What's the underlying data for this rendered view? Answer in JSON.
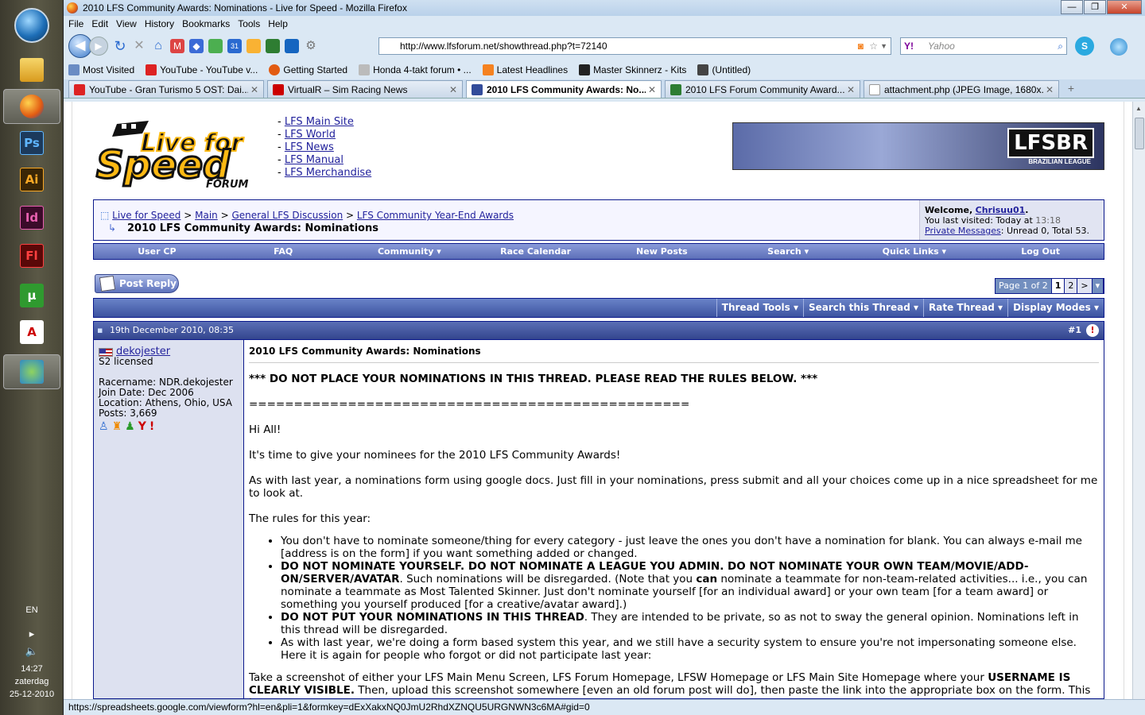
{
  "taskbar": {
    "language": "EN",
    "time": "14:27",
    "day": "zaterdag",
    "date": "25-12-2010",
    "apps": [
      {
        "label": "Ps",
        "color": "#1c3a5c",
        "fg": "#5fb6ff"
      },
      {
        "label": "Ai",
        "color": "#3a2606",
        "fg": "#f9a825"
      },
      {
        "label": "Id",
        "color": "#3b0b2a",
        "fg": "#e860b0"
      },
      {
        "label": "Fl",
        "color": "#5a0808",
        "fg": "#ff4040"
      }
    ]
  },
  "browser": {
    "title": "2010 LFS Community Awards: Nominations - Live for Speed - Mozilla Firefox",
    "menu": [
      "File",
      "Edit",
      "View",
      "History",
      "Bookmarks",
      "Tools",
      "Help"
    ],
    "url": "http://www.lfsforum.net/showthread.php?t=72140",
    "search_placeholder": "Yahoo",
    "bookmarks": [
      "Most Visited",
      "YouTube - YouTube v...",
      "Getting Started",
      "Honda 4-takt forum • ...",
      "Latest Headlines",
      "Master Skinnerz - Kits",
      "(Untitled)"
    ],
    "tabs": [
      {
        "label": "YouTube - Gran Turismo 5 OST: Dai...",
        "selected": false
      },
      {
        "label": "VirtualR – Sim Racing News",
        "selected": false
      },
      {
        "label": "2010 LFS Community Awards: No...",
        "selected": true
      },
      {
        "label": "2010 LFS Forum Community Award...",
        "selected": false
      },
      {
        "label": "attachment.php (JPEG Image, 1680x...",
        "selected": false
      }
    ],
    "status": "https://spreadsheets.google.com/viewform?hl=en&pli=1&formkey=dExXakxNQ0JmU2RhdXZNQU5URGNWN3c6MA#gid=0"
  },
  "header": {
    "logo_line1": "Live for",
    "logo_line2": "Speed",
    "logo_line3": "FORUM",
    "links": [
      "LFS Main Site",
      "LFS World",
      "LFS News",
      "LFS Manual",
      "LFS Merchandise"
    ],
    "banner": "LFSBR",
    "banner_sub": "BRAZILIAN LEAGUE"
  },
  "breadcrumb": {
    "items": [
      "Live for Speed",
      "Main",
      "General LFS Discussion",
      "LFS Community Year-End Awards"
    ],
    "title": "2010 LFS Community Awards: Nominations"
  },
  "welcome": {
    "prefix": "Welcome,",
    "user": "Chrisuu01",
    "last_visit_label": "You last visited: Today at",
    "last_visit_time": "13:18",
    "pm_link": "Private Messages",
    "pm_text": ": Unread 0, Total 53."
  },
  "navstrip": [
    "User CP",
    "FAQ",
    "Community ▾",
    "Race Calendar",
    "New Posts",
    "Search ▾",
    "Quick Links ▾",
    "Log Out"
  ],
  "post_reply": "Post Reply",
  "pager": {
    "label": "Page 1 of 2",
    "pages": [
      "1",
      "2",
      ">",
      "▾"
    ]
  },
  "thread_tools": [
    "Thread Tools ▾",
    "Search this Thread ▾",
    "Rate Thread ▾",
    "Display Modes ▾"
  ],
  "post": {
    "date": "19th December 2010, 08:35",
    "number": "#1",
    "user": {
      "name": "dekojester",
      "rank": "S2 licensed",
      "racername": "Racername: NDR.dekojester",
      "joined": "Join Date: Dec 2006",
      "location": "Location: Athens, Ohio, USA",
      "posts": "Posts: 3,669"
    },
    "title": "2010 LFS Community Awards: Nominations",
    "warning": "*** DO NOT PLACE YOUR NOMINATIONS IN THIS THREAD. PLEASE READ THE RULES BELOW. ***",
    "divider": "=================================================",
    "greeting": "Hi All!",
    "p1": "It's time to give your nominees for the 2010 LFS Community Awards!",
    "p2": "As with last year, a nominations form using google docs. Just fill in your nominations, press submit and all your choices come up in a nice spreadsheet for me to look at.",
    "rules_intro": "The rules for this year:",
    "rule1": "You don't have to nominate someone/thing for every category - just leave the ones you don't have a nomination for blank. You can always e-mail me [address is on the form] if you want something added or changed.",
    "rule2_bold": "DO NOT NOMINATE YOURSELF. DO NOT NOMINATE A LEAGUE YOU ADMIN. DO NOT NOMINATE YOUR OWN TEAM/MOVIE/ADD-ON/SERVER/AVATAR",
    "rule2_a": ". Such nominations will be disregarded. (Note that you ",
    "rule2_can": "can",
    "rule2_b": " nominate a teammate for non-team-related activities... i.e., you can nominate a teammate as Most Talented Skinner. Just don't nominate yourself [for an individual award] or your own team [for a team award] or something you yourself produced [for a creative/avatar award].)",
    "rule3_bold": "DO NOT PUT YOUR NOMINATIONS IN THIS THREAD",
    "rule3": ". They are intended to be private, so as not to sway the general opinion. Nominations left in this thread will be disregarded.",
    "rule4": "As with last year, we're doing a form based system this year, and we still have a security system to ensure you're not impersonating someone else. Here it is again for people who forgot or did not participate last year:",
    "p3_a": "Take a screenshot of either your LFS Main Menu Screen, LFS Forum Homepage, LFSW Homepage or LFS Main Site Homepage where your ",
    "p3_bold": "USERNAME IS CLEARLY VISIBLE.",
    "p3_b": " Then, upload this screenshot somewhere [even an old forum post will do], then paste the link into the appropriate box on the form. This is"
  }
}
